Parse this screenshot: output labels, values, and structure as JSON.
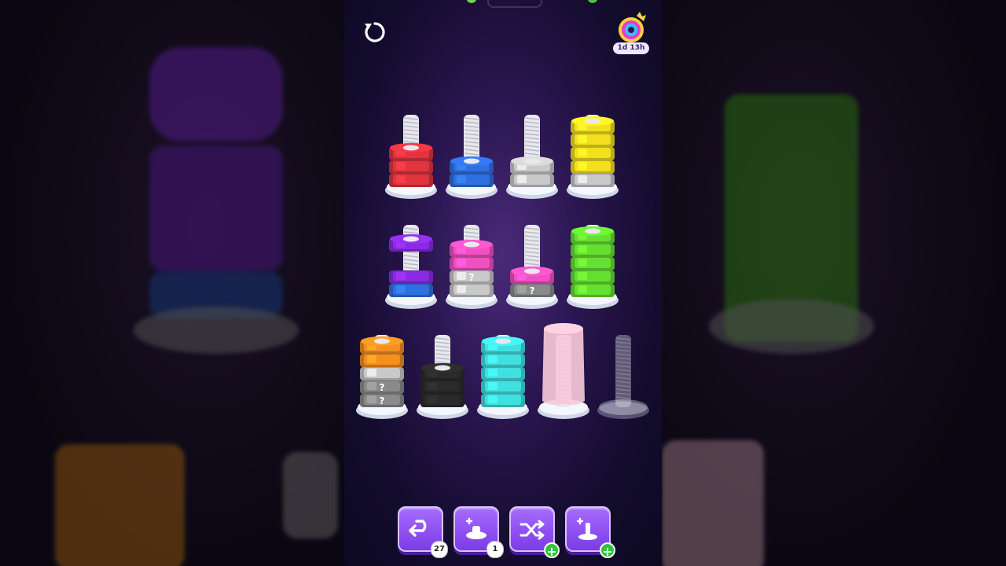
{
  "event": {
    "timer": "1d 13h"
  },
  "tools": [
    {
      "name": "undo",
      "count": "27",
      "badge": "count"
    },
    {
      "name": "add-post",
      "count": "1",
      "badge": "count"
    },
    {
      "name": "shuffle",
      "count": "",
      "badge": "plus"
    },
    {
      "name": "add-screw",
      "count": "",
      "badge": "plus"
    }
  ],
  "colors": {
    "red": "#e0343f",
    "blue": "#2f6fe0",
    "gray": "#c9c9c9",
    "yellow": "#f2e020",
    "purple": "#8a2be2",
    "pink": "#f050c0",
    "green": "#66e030",
    "orange": "#f39020",
    "dark_gray": "#8a8a8a",
    "black": "#2a2a2a",
    "cyan": "#40e0e0",
    "pale_pink": "#f6c8d8"
  },
  "posts": [
    {
      "row": 0,
      "col": 0,
      "nuts": [
        "red",
        "red",
        "red"
      ],
      "lifted": false,
      "hidden": []
    },
    {
      "row": 0,
      "col": 1,
      "nuts": [
        "blue",
        "blue"
      ],
      "lifted": false,
      "hidden": []
    },
    {
      "row": 0,
      "col": 2,
      "nuts": [
        "gray",
        "gray"
      ],
      "lifted": false,
      "hidden": []
    },
    {
      "row": 0,
      "col": 3,
      "nuts": [
        "gray",
        "yellow",
        "yellow",
        "yellow",
        "yellow"
      ],
      "lifted": false,
      "hidden": []
    },
    {
      "row": 1,
      "col": 0,
      "nuts": [
        "blue",
        "purple",
        "purple"
      ],
      "lifted": true,
      "hidden": []
    },
    {
      "row": 1,
      "col": 1,
      "nuts": [
        "gray",
        "gray",
        "pink",
        "pink"
      ],
      "lifted": false,
      "hidden": [
        1
      ]
    },
    {
      "row": 1,
      "col": 2,
      "nuts": [
        "dark_gray",
        "pink"
      ],
      "lifted": false,
      "hidden": [
        0
      ]
    },
    {
      "row": 1,
      "col": 3,
      "nuts": [
        "green",
        "green",
        "green",
        "green",
        "green"
      ],
      "lifted": false,
      "hidden": []
    },
    {
      "row": 2,
      "col": 0,
      "nuts": [
        "dark_gray",
        "dark_gray",
        "gray",
        "orange",
        "orange"
      ],
      "lifted": false,
      "hidden": [
        0,
        1
      ]
    },
    {
      "row": 2,
      "col": 1,
      "nuts": [
        "black",
        "black",
        "black"
      ],
      "lifted": false,
      "hidden": []
    },
    {
      "row": 2,
      "col": 2,
      "nuts": [
        "cyan",
        "cyan",
        "cyan",
        "cyan",
        "cyan"
      ],
      "lifted": false,
      "hidden": []
    },
    {
      "row": 2,
      "col": 3,
      "nuts": [],
      "lifted": false,
      "hidden": [],
      "covered": true,
      "cover_color": "pale_pink"
    },
    {
      "row": 2,
      "col": 4,
      "nuts": [],
      "lifted": false,
      "hidden": [],
      "locked": true
    }
  ],
  "hidden_nut_symbol": "?"
}
